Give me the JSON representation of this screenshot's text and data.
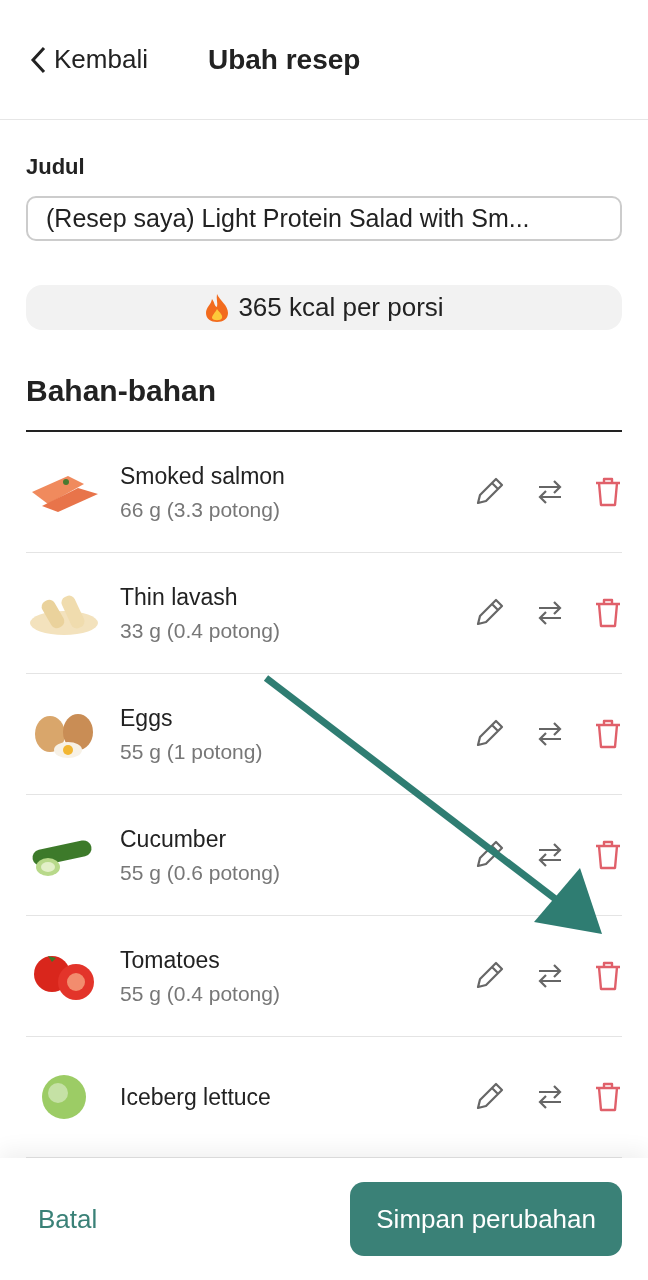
{
  "header": {
    "back": "Kembali",
    "title": "Ubah resep"
  },
  "title_field": {
    "label": "Judul",
    "value": "(Resep saya) Light Protein Salad with Sm..."
  },
  "calories": "365 kcal per porsi",
  "ingredients": {
    "heading": "Bahan-bahan",
    "items": [
      {
        "name": "Smoked salmon",
        "amount": "66 g (3.3 potong)",
        "kind": "salmon"
      },
      {
        "name": "Thin lavash",
        "amount": "33 g (0.4 potong)",
        "kind": "lavash"
      },
      {
        "name": "Eggs",
        "amount": "55 g (1 potong)",
        "kind": "eggs"
      },
      {
        "name": "Cucumber",
        "amount": "55 g (0.6 potong)",
        "kind": "cucumber"
      },
      {
        "name": "Tomatoes",
        "amount": "55 g (0.4 potong)",
        "kind": "tomatoes"
      },
      {
        "name": "Iceberg lettuce",
        "kind": "lettuce"
      }
    ]
  },
  "footer": {
    "cancel": "Batal",
    "save": "Simpan perubahan"
  }
}
